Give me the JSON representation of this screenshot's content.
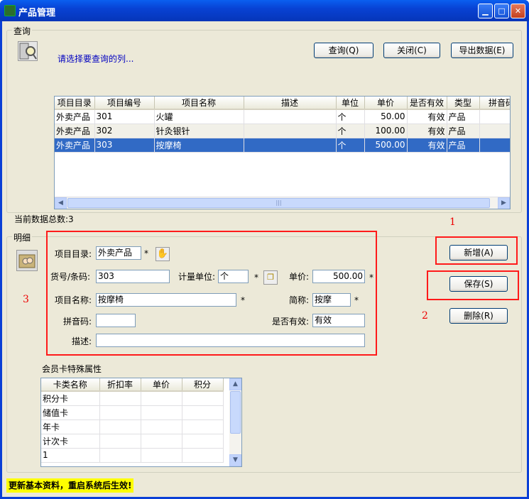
{
  "window": {
    "title": "产品管理"
  },
  "query": {
    "group_label": "查询",
    "hint": "请选择要查询的列...",
    "query_btn": "查询(Q)",
    "close_btn": "关闭(C)",
    "export_btn": "导出数据(E)",
    "columns": [
      "项目目录",
      "项目编号",
      "项目名称",
      "描述",
      "单位",
      "单价",
      "是否有效",
      "类型",
      "拼音码"
    ],
    "rows": [
      [
        "外卖产品",
        "301",
        "火罐",
        "",
        "个",
        "50.00",
        "有效",
        "产品",
        ""
      ],
      [
        "外卖产品",
        "302",
        "针灸银针",
        "",
        "个",
        "100.00",
        "有效",
        "产品",
        ""
      ],
      [
        "外卖产品",
        "303",
        "按摩椅",
        "",
        "个",
        "500.00",
        "有效",
        "产品",
        ""
      ]
    ],
    "total": "当前数据总数:3"
  },
  "detail": {
    "group_label": "明细",
    "catalog_label": "项目目录:",
    "catalog_value": "外卖产品",
    "code_label": "货号/条码:",
    "code_value": "303",
    "unit_label": "计量单位:",
    "unit_value": "个",
    "price_label": "单价:",
    "price_value": "500.00",
    "name_label": "项目名称:",
    "name_value": "按摩椅",
    "short_label": "简称:",
    "short_value": "按摩",
    "pinyin_label": "拼音码:",
    "pinyin_value": "",
    "valid_label": "是否有效:",
    "valid_value": "有效",
    "desc_label": "描述:",
    "desc_value": "",
    "required": "*",
    "add_btn": "新增(A)",
    "save_btn": "保存(S)",
    "delete_btn": "删除(R)"
  },
  "card": {
    "title": "会员卡特殊属性",
    "columns": [
      "卡类名称",
      "折扣率",
      "单价",
      "积分"
    ],
    "rows": [
      [
        "积分卡",
        "",
        "",
        ""
      ],
      [
        "储值卡",
        "",
        "",
        ""
      ],
      [
        "年卡",
        "",
        "",
        ""
      ],
      [
        "计次卡",
        "",
        "",
        ""
      ],
      [
        "1",
        "",
        "",
        ""
      ]
    ]
  },
  "annotations": {
    "n1": "1",
    "n2": "2",
    "n3": "3"
  },
  "status": "更新基本资料，重启系统后生效!"
}
